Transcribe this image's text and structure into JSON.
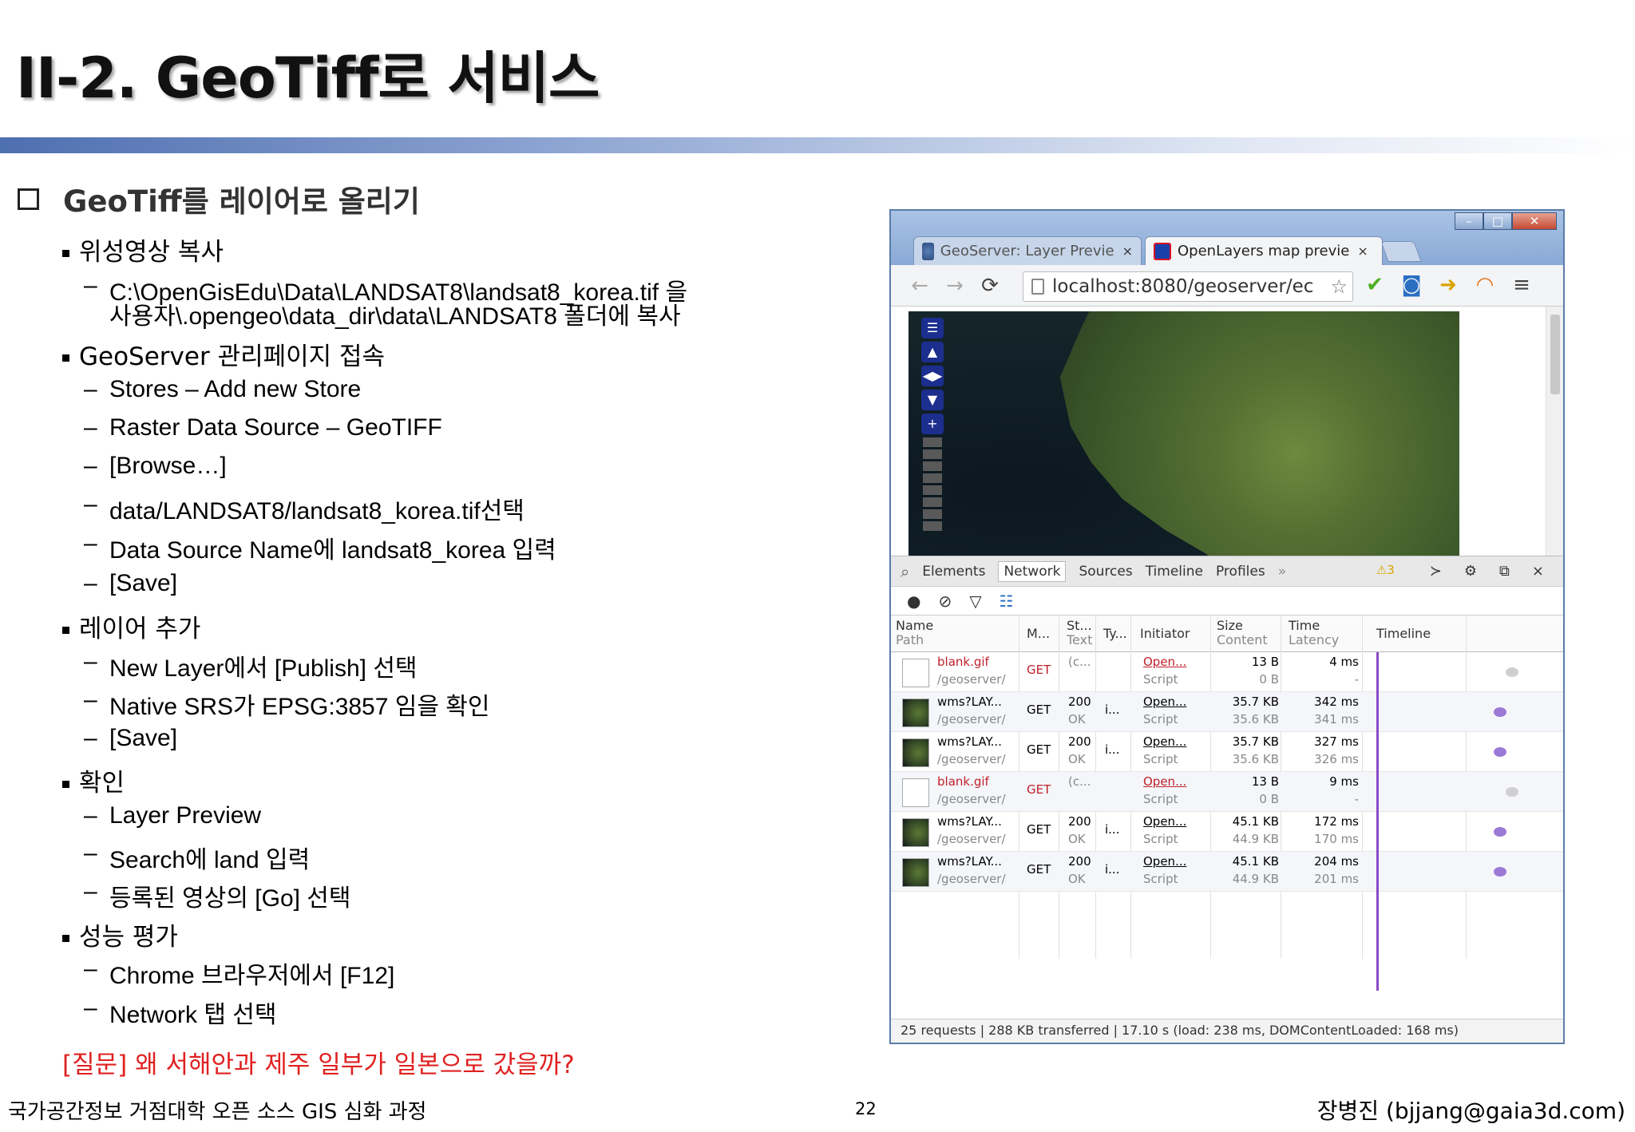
{
  "slide": {
    "title": "II-2. GeoTiff로 서비스",
    "section": "GeoTiff를 레이어로 올리기",
    "items": [
      {
        "level": 1,
        "text": "위성영상 복사"
      },
      {
        "level": 2,
        "text": "C:\\OpenGisEdu\\Data\\LANDSAT8\\landsat8_korea.tif 을"
      },
      {
        "level": 2,
        "text": "사용자\\.opengeo\\data_dir\\data\\LANDSAT8 폴더에 복사"
      },
      {
        "level": 1,
        "text": "GeoServer 관리페이지 접속"
      },
      {
        "level": 2,
        "text": "Stores – Add new Store"
      },
      {
        "level": 2,
        "text": "Raster Data Source – GeoTIFF"
      },
      {
        "level": 2,
        "text": "[Browse…]"
      },
      {
        "level": 2,
        "text": "data/LANDSAT8/landsat8_korea.tif선택"
      },
      {
        "level": 2,
        "text": "Data Source Name에 landsat8_korea 입력"
      },
      {
        "level": 2,
        "text": "[Save]"
      },
      {
        "level": 1,
        "text": "레이어 추가"
      },
      {
        "level": 2,
        "text": "New Layer에서 [Publish] 선택"
      },
      {
        "level": 2,
        "text": "Native SRS가 EPSG:3857 임을 확인"
      },
      {
        "level": 2,
        "text": "[Save]"
      },
      {
        "level": 1,
        "text": "확인"
      },
      {
        "level": 2,
        "text": "Layer Preview"
      },
      {
        "level": 2,
        "text": "Search에 land 입력"
      },
      {
        "level": 2,
        "text": "등록된 영상의 [Go] 선택"
      },
      {
        "level": 1,
        "text": "성능 평가"
      },
      {
        "level": 2,
        "text": "Chrome 브라우저에서 [F12]"
      },
      {
        "level": 2,
        "text": "Network 탭 선택"
      }
    ],
    "question": "[질문] 왜 서해안과 제주 일부가 일본으로 갔을까?",
    "footer_left": "국가공간정보 거점대학 오픈 소스 GIS 심화 과정",
    "page_number": "22",
    "footer_right": "장병진 (bjjang@gaia3d.com)"
  },
  "browser": {
    "tabs": [
      {
        "label": "GeoServer: Layer Previe",
        "close": "×",
        "icon": "geoserver-icon"
      },
      {
        "label": "OpenLayers map previe",
        "close": "×",
        "icon": "openlayers-icon"
      }
    ],
    "window_buttons": {
      "minimize": "–",
      "maximize": "□",
      "close": "✕"
    },
    "address": "localhost:8080/geoserver/ec",
    "devtools": {
      "tabs": [
        "Elements",
        "Network",
        "Sources",
        "Timeline",
        "Profiles",
        "»"
      ],
      "warnings": "3",
      "columns": {
        "name": [
          "Name",
          "Path"
        ],
        "method": [
          "M..."
        ],
        "status": [
          "St...",
          "Text"
        ],
        "type": [
          "Ty..."
        ],
        "initiator": [
          "Initiator"
        ],
        "size": [
          "Size",
          "Content"
        ],
        "time": [
          "Time",
          "Latency"
        ],
        "timeline": [
          "Timeline"
        ]
      },
      "rows": [
        {
          "name": "blank.gif",
          "path": "/geoserver/",
          "method": "GET",
          "status": "(c...",
          "text": "",
          "type": "",
          "initiator": "Open...",
          "itype": "Script",
          "size": "13 B",
          "content": "0 B",
          "time": "4 ms",
          "latency": "-",
          "thumb": "blank",
          "red": true
        },
        {
          "name": "wms?LAY...",
          "path": "/geoserver/",
          "method": "GET",
          "status": "200",
          "text": "OK",
          "type": "i...",
          "initiator": "Open...",
          "itype": "Script",
          "size": "35.7 KB",
          "content": "35.6 KB",
          "time": "342 ms",
          "latency": "341 ms",
          "thumb": "sat",
          "red": false
        },
        {
          "name": "wms?LAY...",
          "path": "/geoserver/",
          "method": "GET",
          "status": "200",
          "text": "OK",
          "type": "i...",
          "initiator": "Open...",
          "itype": "Script",
          "size": "35.7 KB",
          "content": "35.6 KB",
          "time": "327 ms",
          "latency": "326 ms",
          "thumb": "sat",
          "red": false
        },
        {
          "name": "blank.gif",
          "path": "/geoserver/",
          "method": "GET",
          "status": "(c...",
          "text": "",
          "type": "",
          "initiator": "Open...",
          "itype": "Script",
          "size": "13 B",
          "content": "0 B",
          "time": "9 ms",
          "latency": "-",
          "thumb": "blank",
          "red": true
        },
        {
          "name": "wms?LAY...",
          "path": "/geoserver/",
          "method": "GET",
          "status": "200",
          "text": "OK",
          "type": "i...",
          "initiator": "Open...",
          "itype": "Script",
          "size": "45.1 KB",
          "content": "44.9 KB",
          "time": "172 ms",
          "latency": "170 ms",
          "thumb": "sat",
          "red": false
        },
        {
          "name": "wms?LAY...",
          "path": "/geoserver/",
          "method": "GET",
          "status": "200",
          "text": "OK",
          "type": "i...",
          "initiator": "Open...",
          "itype": "Script",
          "size": "45.1 KB",
          "content": "44.9 KB",
          "time": "204 ms",
          "latency": "201 ms",
          "thumb": "sat",
          "red": false
        }
      ],
      "status": "25 requests | 288 KB transferred | 17.10 s (load: 238 ms, DOMContentLoaded: 168 ms)"
    }
  },
  "colors": {
    "accent": "#4e6fb0",
    "question": "#e02020",
    "timeline": "#8b49c7"
  }
}
